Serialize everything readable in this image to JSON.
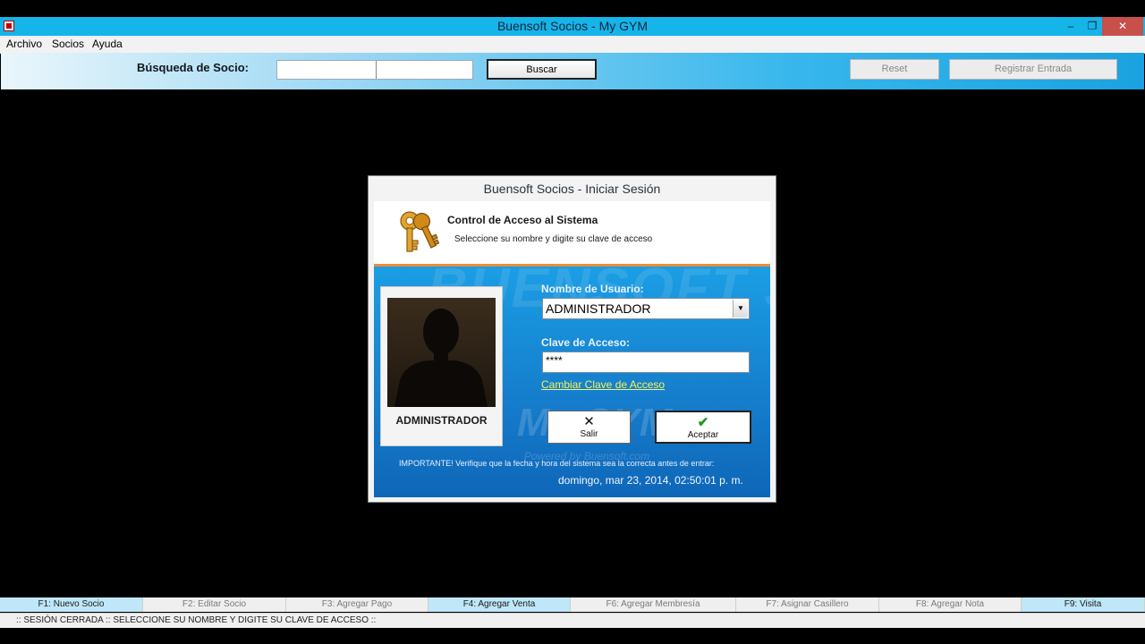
{
  "window": {
    "title": "Buensoft Socios - My GYM",
    "min_glyph": "‒",
    "max_glyph": "❐",
    "close_glyph": "✕"
  },
  "menu": {
    "items": [
      "Archivo",
      "Socios",
      "Ayuda"
    ]
  },
  "toolbar": {
    "search_label": "Búsqueda de Socio:",
    "search_value": "",
    "search_button": "Buscar",
    "reset_button": "Reset",
    "register_button": "Registrar Entrada"
  },
  "login_dialog": {
    "title": "Buensoft Socios - Iniciar Sesión",
    "heading": "Control de Acceso al Sistema",
    "subheading": "Seleccione su nombre y digite su clave de acceso",
    "watermark_brand": "BUENSOFT SOCIOS",
    "watermark_app": "My GYM",
    "watermark_powered": "Powered by Buensoft.com",
    "photo_name": "ADMINISTRADOR",
    "username_label": "Nombre de Usuario:",
    "username_value": "ADMINISTRADOR",
    "password_label": "Clave de Acceso:",
    "password_value": "****",
    "change_password_link": "Cambiar Clave de Acceso",
    "exit_button": "Salir",
    "accept_button": "Aceptar",
    "notice": "IMPORTANTE! Verifique que la fecha y hora del sistema sea la correcta antes de entrar:",
    "datetime": "domingo, mar 23, 2014, 02:50:01 p. m."
  },
  "fkeys": [
    {
      "label": "F1: Nuevo Socio",
      "active": true
    },
    {
      "label": "F2: Editar Socio",
      "active": false
    },
    {
      "label": "F3: Agregar Pago",
      "active": false
    },
    {
      "label": "F4: Agregar Venta",
      "active": true
    },
    {
      "label": "F6: Agregar Membresía",
      "active": false
    },
    {
      "label": "F7: Asignar Casillero",
      "active": false
    },
    {
      "label": "F8: Agregar Nota",
      "active": false
    },
    {
      "label": "F9: Visita",
      "active": true
    }
  ],
  "status": {
    "text": ":: SESIÓN CERRADA  ::  SELECCIONE SU NOMBRE Y DIGITE SU CLAVE DE ACCESO  ::"
  },
  "colors": {
    "titlebar": "#15b4e9",
    "dialog_body": "#157ccb",
    "header_accent": "#f08a34",
    "link": "#f6f35a",
    "close_button": "#c7504a"
  }
}
